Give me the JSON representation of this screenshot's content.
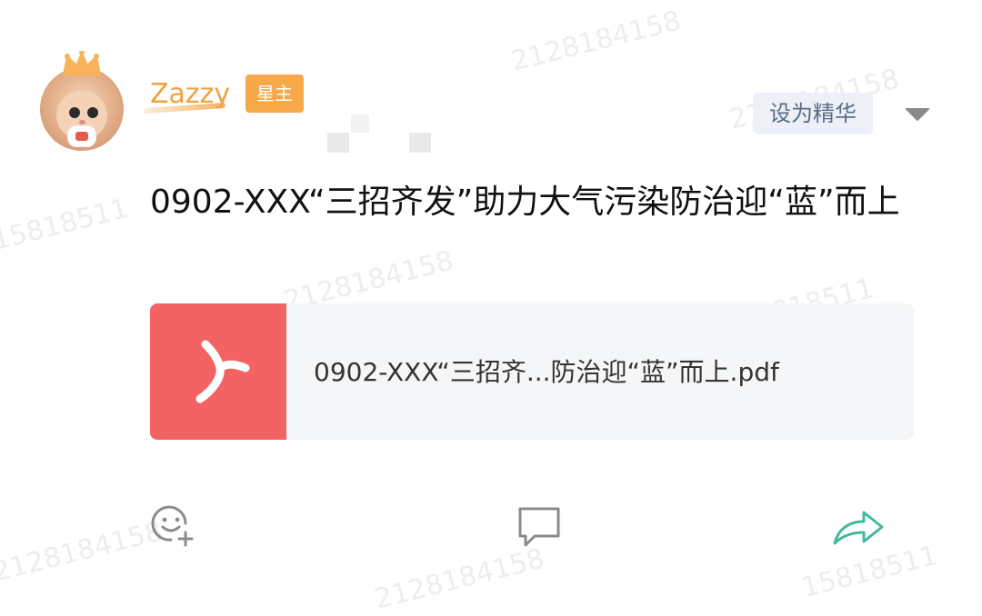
{
  "user": {
    "name": "Zazzy",
    "badge": "星主"
  },
  "header": {
    "feature_button": "设为精华",
    "more_icon": "triangle-down-icon"
  },
  "post": {
    "title": "0902-XXX“三招齐发”助力大气污染防治迎“蓝”而上"
  },
  "attachment": {
    "file_icon": "pdf-icon",
    "file_color": "#f36364",
    "file_name": "0902-XXX“三招齐...防治迎“蓝”而上.pdf"
  },
  "actions": {
    "react_icon": "smiley-add-icon",
    "comment_icon": "comment-bubble-icon",
    "share_icon": "share-arrow-icon",
    "share_color": "#45b89f"
  },
  "watermark": {
    "text_a": "2128184158",
    "text_b": "15818511"
  }
}
